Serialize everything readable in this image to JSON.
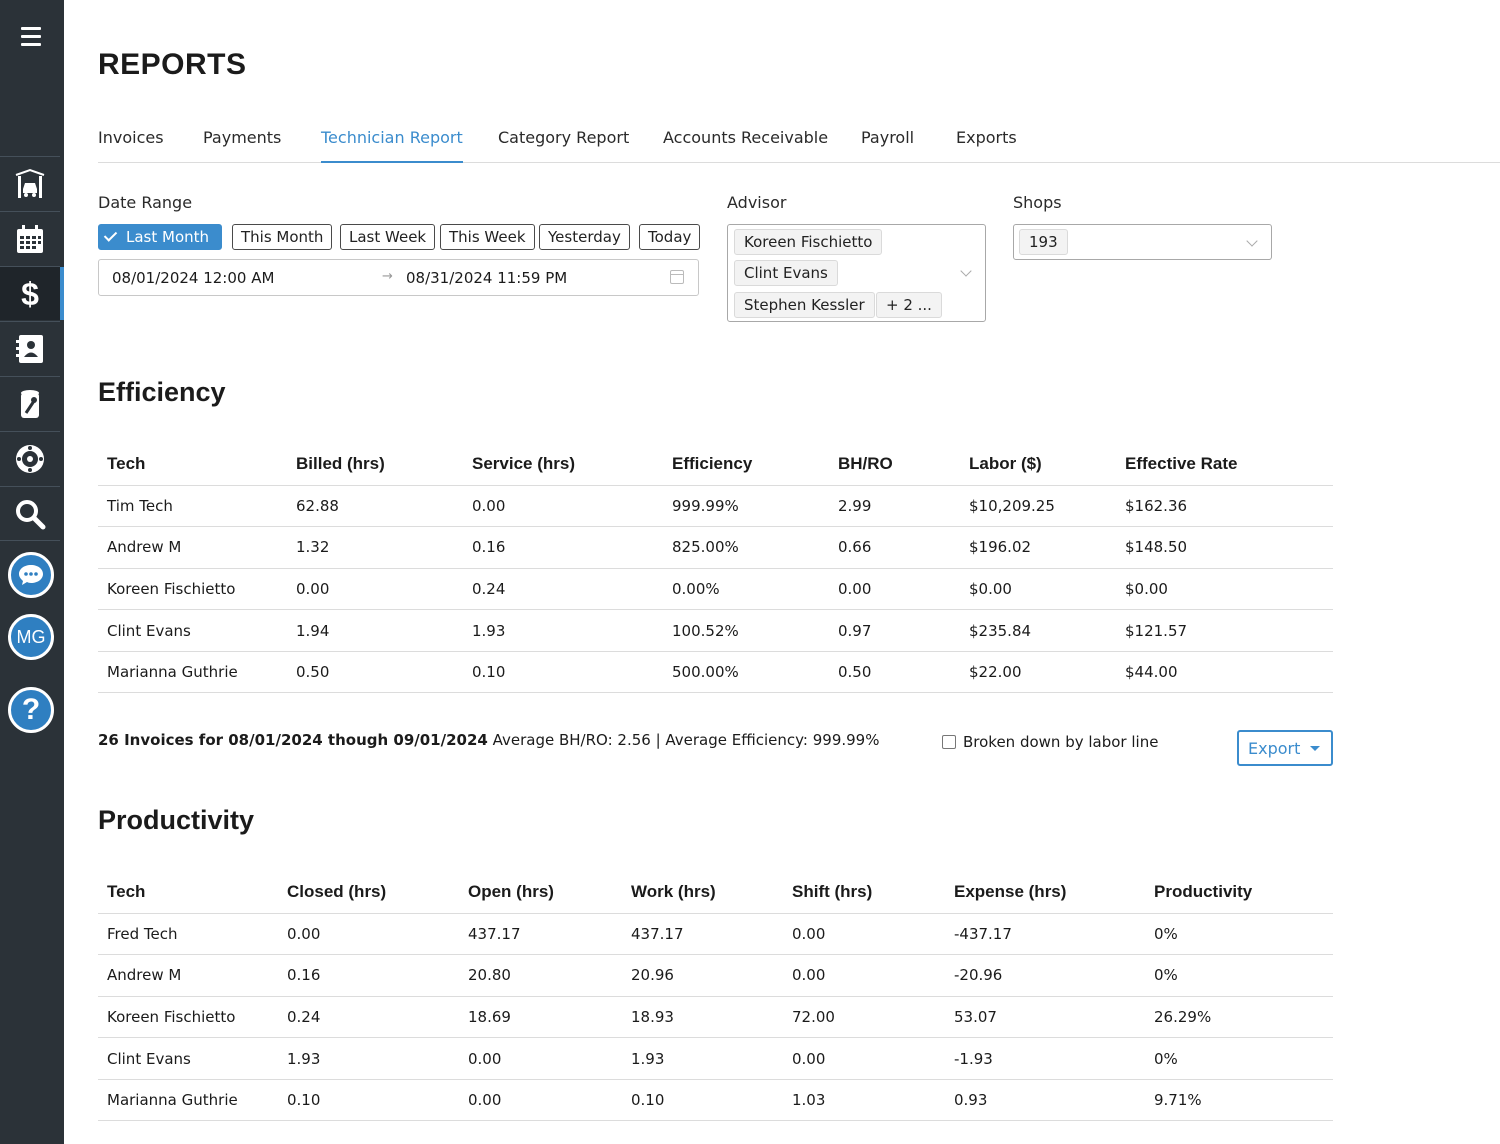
{
  "sidebar": {
    "items": [
      {
        "icon": "garage-lift-icon"
      },
      {
        "icon": "calendar-icon"
      },
      {
        "icon": "dollar-icon",
        "active": true
      },
      {
        "icon": "contacts-icon"
      },
      {
        "icon": "oil-wrench-icon"
      },
      {
        "icon": "tire-icon"
      },
      {
        "icon": "search-icon"
      }
    ],
    "chat_icon": "chat-bubble-icon",
    "user_initials": "MG",
    "help_label": "?"
  },
  "page": {
    "title": "REPORTS"
  },
  "tabs": [
    {
      "label": "Invoices"
    },
    {
      "label": "Payments"
    },
    {
      "label": "Technician Report",
      "active": true
    },
    {
      "label": "Category Report"
    },
    {
      "label": "Accounts Receivable"
    },
    {
      "label": "Payroll"
    },
    {
      "label": "Exports"
    }
  ],
  "filters": {
    "date_range_label": "Date Range",
    "quick_ranges": [
      "Last Month",
      "This Month",
      "Last Week",
      "This Week",
      "Yesterday",
      "Today"
    ],
    "selected_range": "Last Month",
    "start": "08/01/2024 12:00 AM",
    "end": "08/31/2024 11:59 PM",
    "arrow": "→",
    "advisor_label": "Advisor",
    "advisors": [
      "Koreen Fischietto",
      "Clint Evans",
      "Stephen Kessler"
    ],
    "advisors_more": "+ 2 ...",
    "shops_label": "Shops",
    "shops": [
      "193"
    ]
  },
  "efficiency": {
    "title": "Efficiency",
    "columns": [
      "Tech",
      "Billed (hrs)",
      "Service (hrs)",
      "Efficiency",
      "BH/RO",
      "Labor ($)",
      "Effective Rate"
    ],
    "rows": [
      [
        "Tim Tech",
        "62.88",
        "0.00",
        "999.99%",
        "2.99",
        "$10,209.25",
        "$162.36"
      ],
      [
        "Andrew M",
        "1.32",
        "0.16",
        "825.00%",
        "0.66",
        "$196.02",
        "$148.50"
      ],
      [
        "Koreen Fischietto",
        "0.00",
        "0.24",
        "0.00%",
        "0.00",
        "$0.00",
        "$0.00"
      ],
      [
        "Clint Evans",
        "1.94",
        "1.93",
        "100.52%",
        "0.97",
        "$235.84",
        "$121.57"
      ],
      [
        "Marianna Guthrie",
        "0.50",
        "0.10",
        "500.00%",
        "0.50",
        "$22.00",
        "$44.00"
      ]
    ],
    "summary_bold": "26 Invoices for 08/01/2024 though 09/01/2024",
    "summary_rest": " Average BH/RO: 2.56 | Average Efficiency: 999.99%",
    "breakdown_label": "Broken down by labor line",
    "export_label": "Export"
  },
  "productivity": {
    "title": "Productivity",
    "columns": [
      "Tech",
      "Closed (hrs)",
      "Open (hrs)",
      "Work (hrs)",
      "Shift (hrs)",
      "Expense (hrs)",
      "Productivity"
    ],
    "rows": [
      [
        "Fred Tech",
        "0.00",
        "437.17",
        "437.17",
        "0.00",
        "-437.17",
        "0%"
      ],
      [
        "Andrew M",
        "0.16",
        "20.80",
        "20.96",
        "0.00",
        "-20.96",
        "0%"
      ],
      [
        "Koreen Fischietto",
        "0.24",
        "18.69",
        "18.93",
        "72.00",
        "53.07",
        "26.29%"
      ],
      [
        "Clint Evans",
        "1.93",
        "0.00",
        "1.93",
        "0.00",
        "-1.93",
        "0%"
      ],
      [
        "Marianna Guthrie",
        "0.10",
        "0.00",
        "0.10",
        "1.03",
        "0.93",
        "9.71%"
      ]
    ]
  }
}
